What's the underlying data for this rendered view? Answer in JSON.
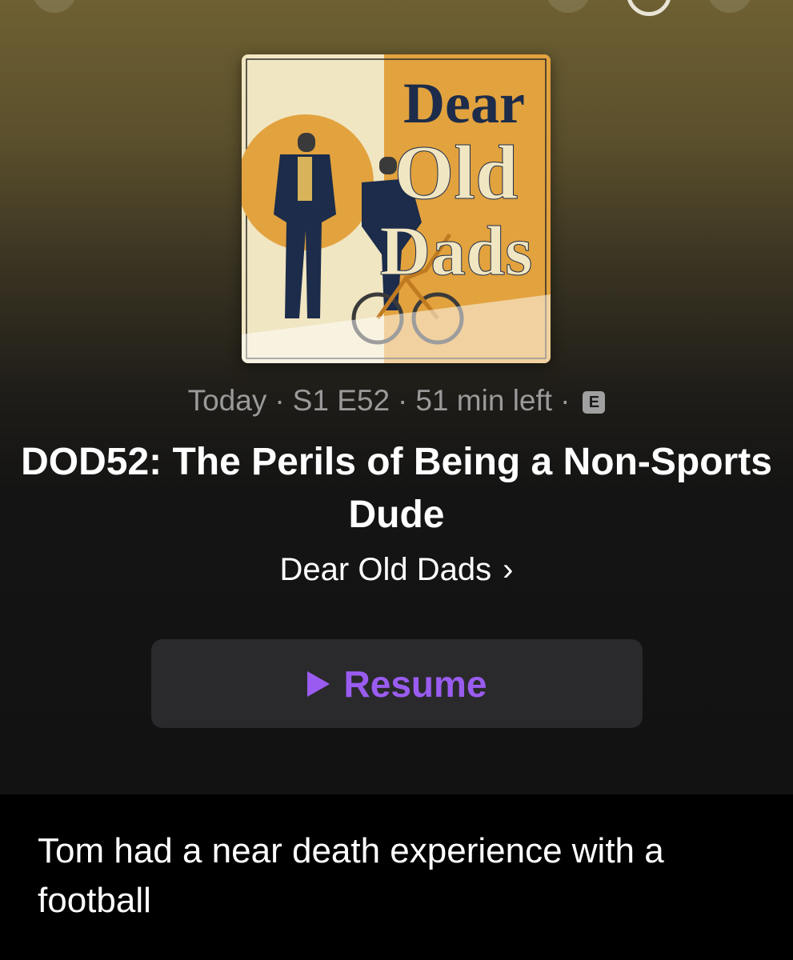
{
  "episode": {
    "meta": {
      "date": "Today",
      "season_episode": "S1 E52",
      "time_left": "51 min left",
      "explicit_badge": "E",
      "separator": "·"
    },
    "title": "DOD52: The Perils of Being a Non-Sports Dude",
    "show_name": "Dear Old Dads",
    "show_chevron": "›",
    "resume_label": "Resume",
    "description": "Tom had a near death experience with a football"
  },
  "artwork": {
    "line1": "Dear",
    "line2": "Old",
    "line3": "Dads"
  },
  "colors": {
    "accent": "#9a5cf0",
    "button_bg": "#2a2a2c",
    "artwork_orange": "#e2a23e",
    "artwork_navy": "#1c2c4a",
    "artwork_cream": "#f1e6c2"
  },
  "icons": {
    "play": "play-triangle",
    "chevron": "chevron-right",
    "explicit": "explicit-badge"
  }
}
